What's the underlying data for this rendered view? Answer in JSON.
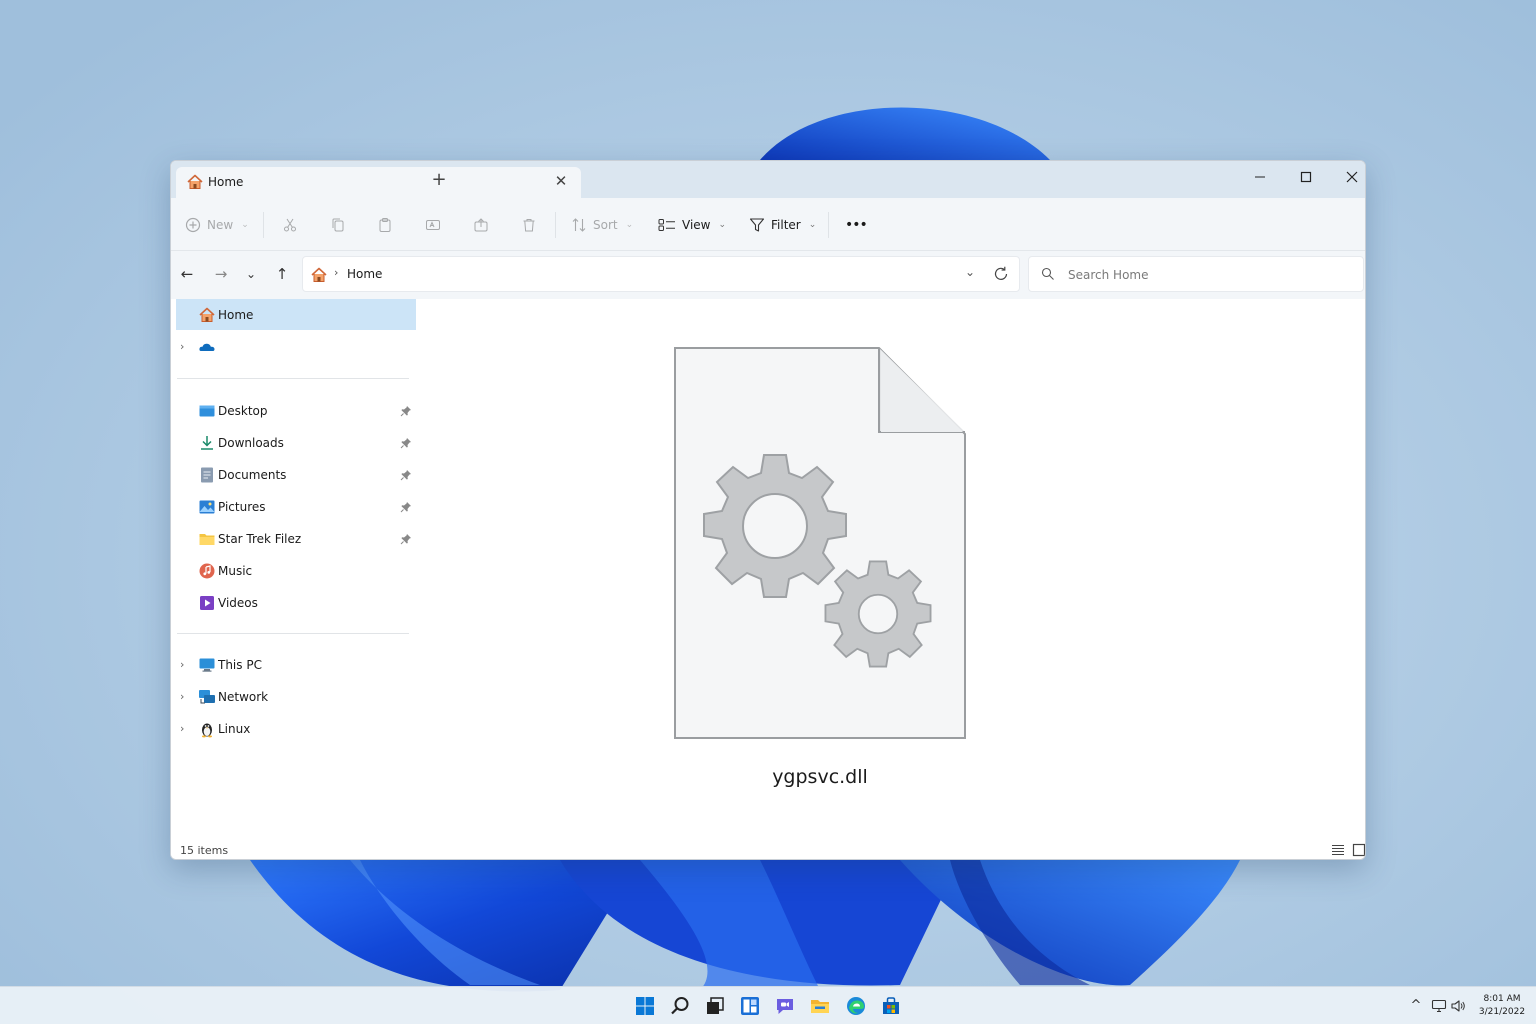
{
  "window": {
    "tab_title": "Home",
    "tab_close_glyph": "✕",
    "new_tab_glyph": "+",
    "controls": {
      "minimize": "—",
      "maximize": "☐",
      "close": "✕"
    }
  },
  "toolbar": {
    "new_label": "New",
    "sort_label": "Sort",
    "view_label": "View",
    "filter_label": "Filter",
    "more_label": "•••",
    "caret": "⌄"
  },
  "navigation": {
    "back": "←",
    "forward": "→",
    "recent": "⌄",
    "up": "↑",
    "breadcrumb_separator": "›",
    "breadcrumb": "Home",
    "address_dropdown": "⌄"
  },
  "search": {
    "placeholder": "Search Home"
  },
  "sidebar": {
    "home": "Home",
    "onedrive": "",
    "quick_access": [
      {
        "label": "Desktop",
        "icon": "desktop-icon"
      },
      {
        "label": "Downloads",
        "icon": "downloads-icon"
      },
      {
        "label": "Documents",
        "icon": "documents-icon"
      },
      {
        "label": "Pictures",
        "icon": "pictures-icon"
      },
      {
        "label": "Star Trek Filez",
        "icon": "folder-icon"
      },
      {
        "label": "Music",
        "icon": "music-icon"
      },
      {
        "label": "Videos",
        "icon": "videos-icon"
      }
    ],
    "locations": [
      {
        "label": "This PC",
        "icon": "monitor-icon"
      },
      {
        "label": "Network",
        "icon": "network-icon"
      },
      {
        "label": "Linux",
        "icon": "linux-penguin-icon"
      }
    ],
    "expand_glyph": "›"
  },
  "content": {
    "file_name": "ygpsvc.dll"
  },
  "status": {
    "item_count": "15 items"
  },
  "taskbar": {
    "tray_up_arrow": "^",
    "time": "8:01 AM",
    "date": "3/21/2022"
  },
  "colors": {
    "accent": "#0067c0",
    "selection": "#cce4f7",
    "folder": "#f4c542",
    "wallpaper_blue": "#1a55e0"
  }
}
